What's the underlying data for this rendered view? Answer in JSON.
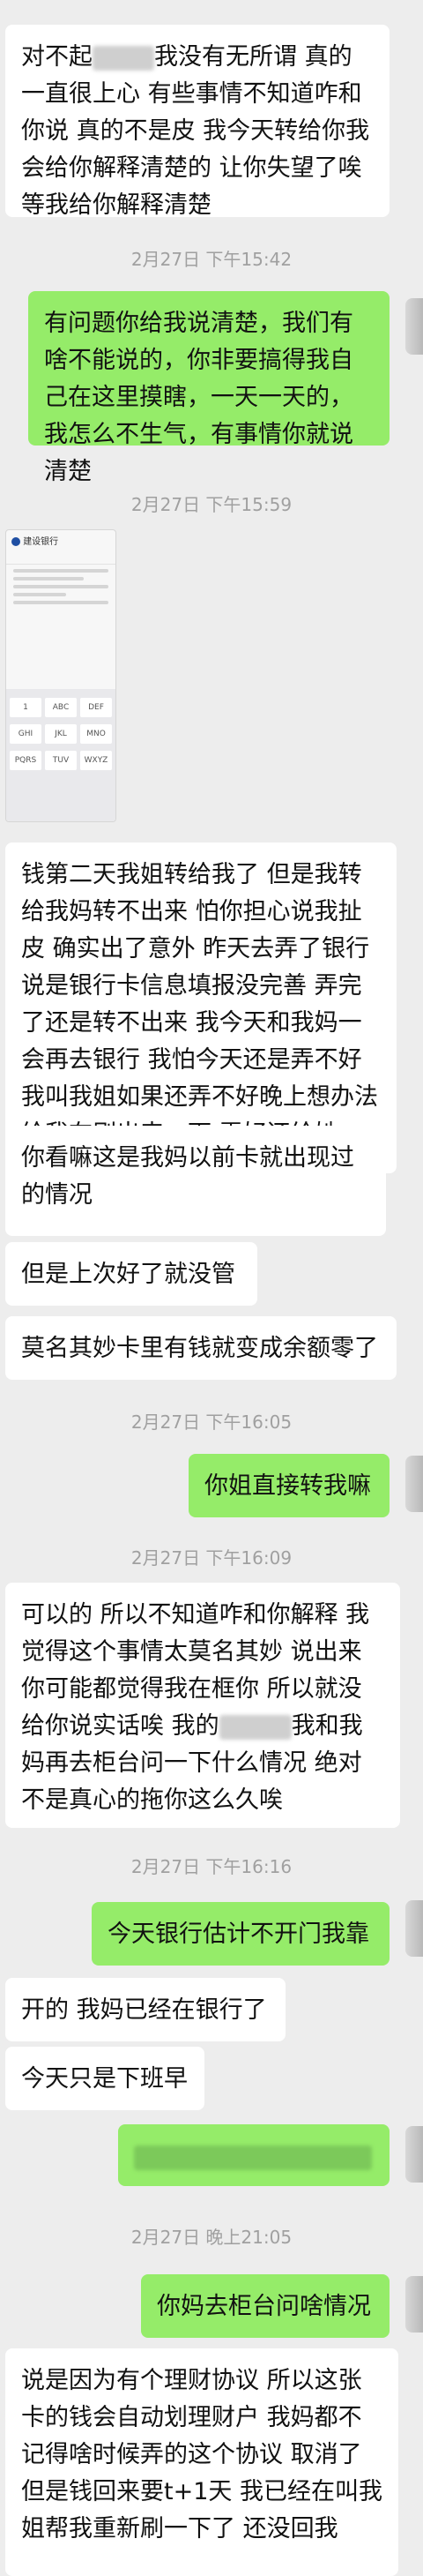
{
  "messages": [
    {
      "id": "m1",
      "side": "left",
      "text_a": "对不起",
      "text_b": "我没有无所谓 真的一直很上心 有些事情不知道咋和你说 真的不是皮 我今天转给你我会给你解释清楚的 让你失望了唉 等我给你解释清楚"
    },
    {
      "id": "t1",
      "time": "2月27日 下午15:42"
    },
    {
      "id": "m2",
      "side": "right",
      "text": "有问题你给我说清楚，我们有啥不能说的，你非要搞得我自己在这里摸瞎，一天一天的，我怎么不生气，有事情你就说清楚"
    },
    {
      "id": "t2",
      "time": "2月27日 下午15:59"
    },
    {
      "id": "img1",
      "side": "left",
      "thumb_title": "建设银行"
    },
    {
      "id": "m3",
      "side": "left",
      "text": "钱第二天我姐转给我了 但是我转给我妈转不出来 怕你担心说我扯皮 确实出了意外 昨天去弄了银行说是银行卡信息填报没完善 弄完了还是转不出来 我今天和我妈一会再去银行 我怕今天还是弄不好我叫我姐如果还弄不好晚上想办法给我在刷出来一下 弄好还给她"
    },
    {
      "id": "m4",
      "side": "left",
      "text": "你看嘛这是我妈以前卡就出现过的情况"
    },
    {
      "id": "m5",
      "side": "left",
      "text": "但是上次好了就没管"
    },
    {
      "id": "m6",
      "side": "left",
      "text": "莫名其妙卡里有钱就变成余额零了"
    },
    {
      "id": "t3",
      "time": "2月27日 下午16:05"
    },
    {
      "id": "m7",
      "side": "right",
      "text": "你姐直接转我嘛"
    },
    {
      "id": "t4",
      "time": "2月27日 下午16:09"
    },
    {
      "id": "m8",
      "side": "left",
      "text_a": "可以的 所以不知道咋和你解释 我觉得这个事情太莫名其妙 说出来你可能都觉得我在框你 所以就没给你说实话唉 我的",
      "text_b": "我和我妈再去柜台问一下什么情况 绝对不是真心的拖你这么久唉"
    },
    {
      "id": "t5",
      "time": "2月27日 下午16:16"
    },
    {
      "id": "m9",
      "side": "right",
      "text": "今天银行估计不开门我靠"
    },
    {
      "id": "m10",
      "side": "left",
      "text": "开的 我妈已经在银行了"
    },
    {
      "id": "m11",
      "side": "left",
      "text": "今天只是下班早"
    },
    {
      "id": "m12",
      "side": "right",
      "text": ""
    },
    {
      "id": "t6",
      "time": "2月27日 晚上21:05"
    },
    {
      "id": "m13",
      "side": "right",
      "text": "你妈去柜台问啥情况"
    },
    {
      "id": "m14",
      "side": "left",
      "text": "说是因为有个理财协议 所以这张卡的钱会自动划理财户 我妈都不记得啥时候弄的这个协议 取消了但是钱回来要t+1天 我已经在叫我姐帮我重新刷一下了 还没回我"
    }
  ],
  "keyboard_keys": [
    "1",
    "ABC",
    "DEF",
    "GHI",
    "JKL",
    "MNO",
    "PQRS",
    "TUV",
    "WXYZ"
  ],
  "colors": {
    "background": "#ededed",
    "bubble_left": "#ffffff",
    "bubble_right": "#95ec69",
    "timestamp": "#a0a0a0"
  }
}
